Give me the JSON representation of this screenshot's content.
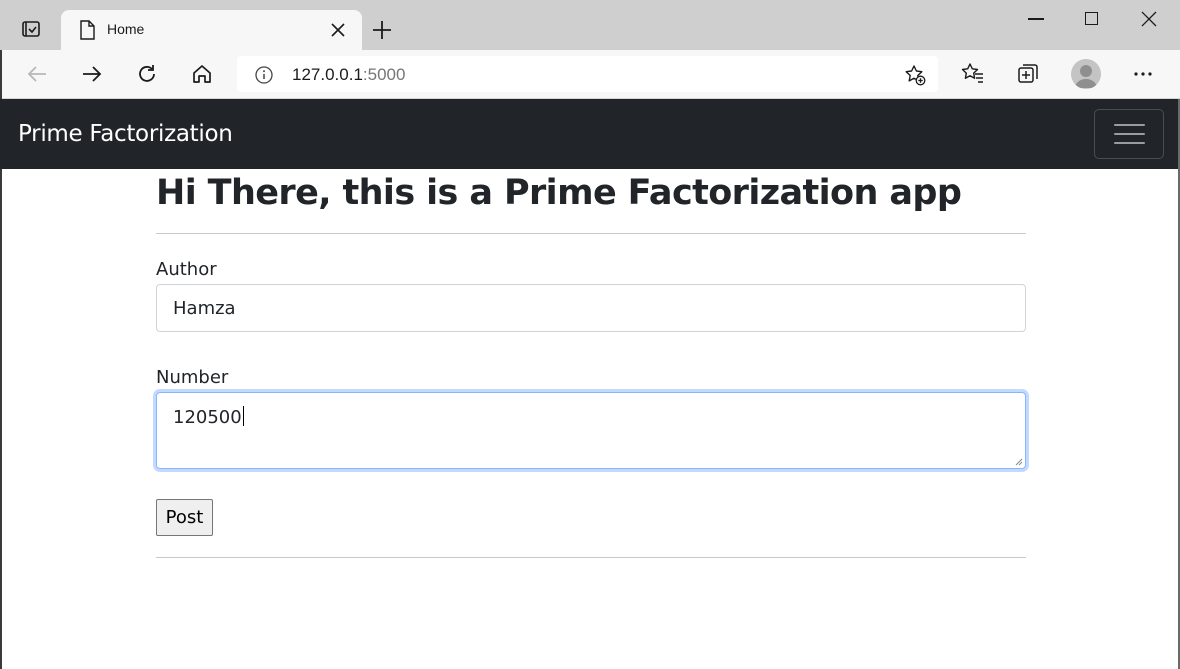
{
  "browser": {
    "tab_title": "Home",
    "url_host": "127.0.0.1",
    "url_port": ":5000"
  },
  "navbar": {
    "brand": "Prime Factorization"
  },
  "main": {
    "heading": "Hi There, this is a Prime Factorization app",
    "author_label": "Author",
    "author_value": "Hamza",
    "number_label": "Number",
    "number_value": "120500",
    "post_label": "Post"
  },
  "colors": {
    "navbar_bg": "#212529",
    "focus_border": "#86b7fe",
    "titlebar_bg": "#cfcfcf"
  }
}
